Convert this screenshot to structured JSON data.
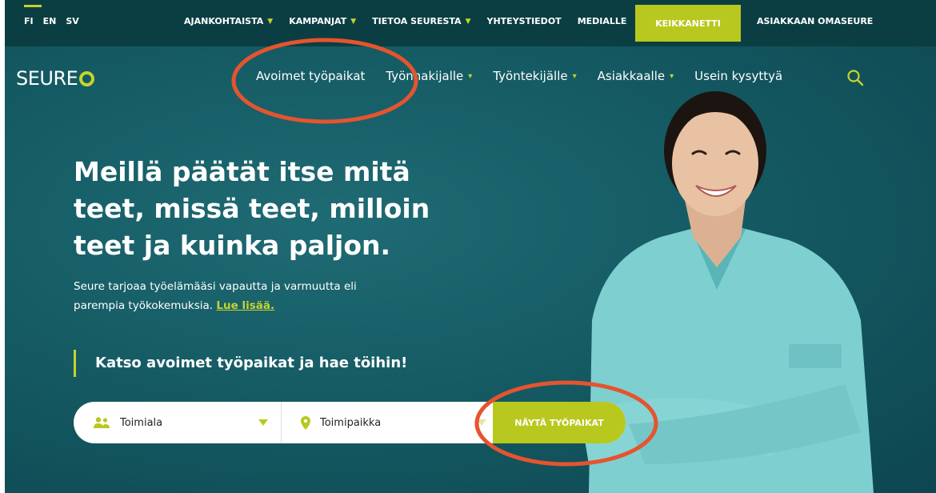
{
  "languages": [
    "FI",
    "EN",
    "SV"
  ],
  "top_nav": [
    {
      "label": "AJANKOHTAISTA",
      "has_dropdown": true
    },
    {
      "label": "KAMPANJAT",
      "has_dropdown": true
    },
    {
      "label": "TIETOA SEURESTA",
      "has_dropdown": true
    },
    {
      "label": "YHTEYSTIEDOT",
      "has_dropdown": false
    },
    {
      "label": "MEDIALLE",
      "has_dropdown": false
    }
  ],
  "keikkanetti_label": "KEIKKANETTI",
  "omaseure_label": "ASIAKKAAN OMASEURE",
  "logo_text": "SEURE",
  "main_nav": [
    {
      "label": "Avoimet työpaikat",
      "has_dropdown": false
    },
    {
      "label": "Työnhakijalle",
      "has_dropdown": true
    },
    {
      "label": "Työntekijälle",
      "has_dropdown": true
    },
    {
      "label": "Asiakkaalle",
      "has_dropdown": true
    },
    {
      "label": "Usein kysyttyä",
      "has_dropdown": false
    }
  ],
  "hero": {
    "title_lines": [
      "Meillä päätät itse mitä",
      "teet, missä teet, milloin",
      "teet ja kuinka paljon."
    ],
    "text_line1": "Seure tarjoaa työelämääsi vapautta ja varmuutta eli",
    "text_line2": "parempia työkokemuksia.",
    "link_label": "Lue lisää."
  },
  "cta_heading": "Katso avoimet työpaikat ja hae töihin!",
  "search_form": {
    "industry_label": "Toimiala",
    "location_label": "Toimipaikka",
    "submit_label": "NÄYTÄ TYÖPAIKAT"
  },
  "colors": {
    "brand_green": "#c6d32d",
    "button_green": "#b8c81f",
    "teal_bg": "#155b64",
    "top_bar": "#0b3e43",
    "annotation_red": "#e5542e"
  }
}
